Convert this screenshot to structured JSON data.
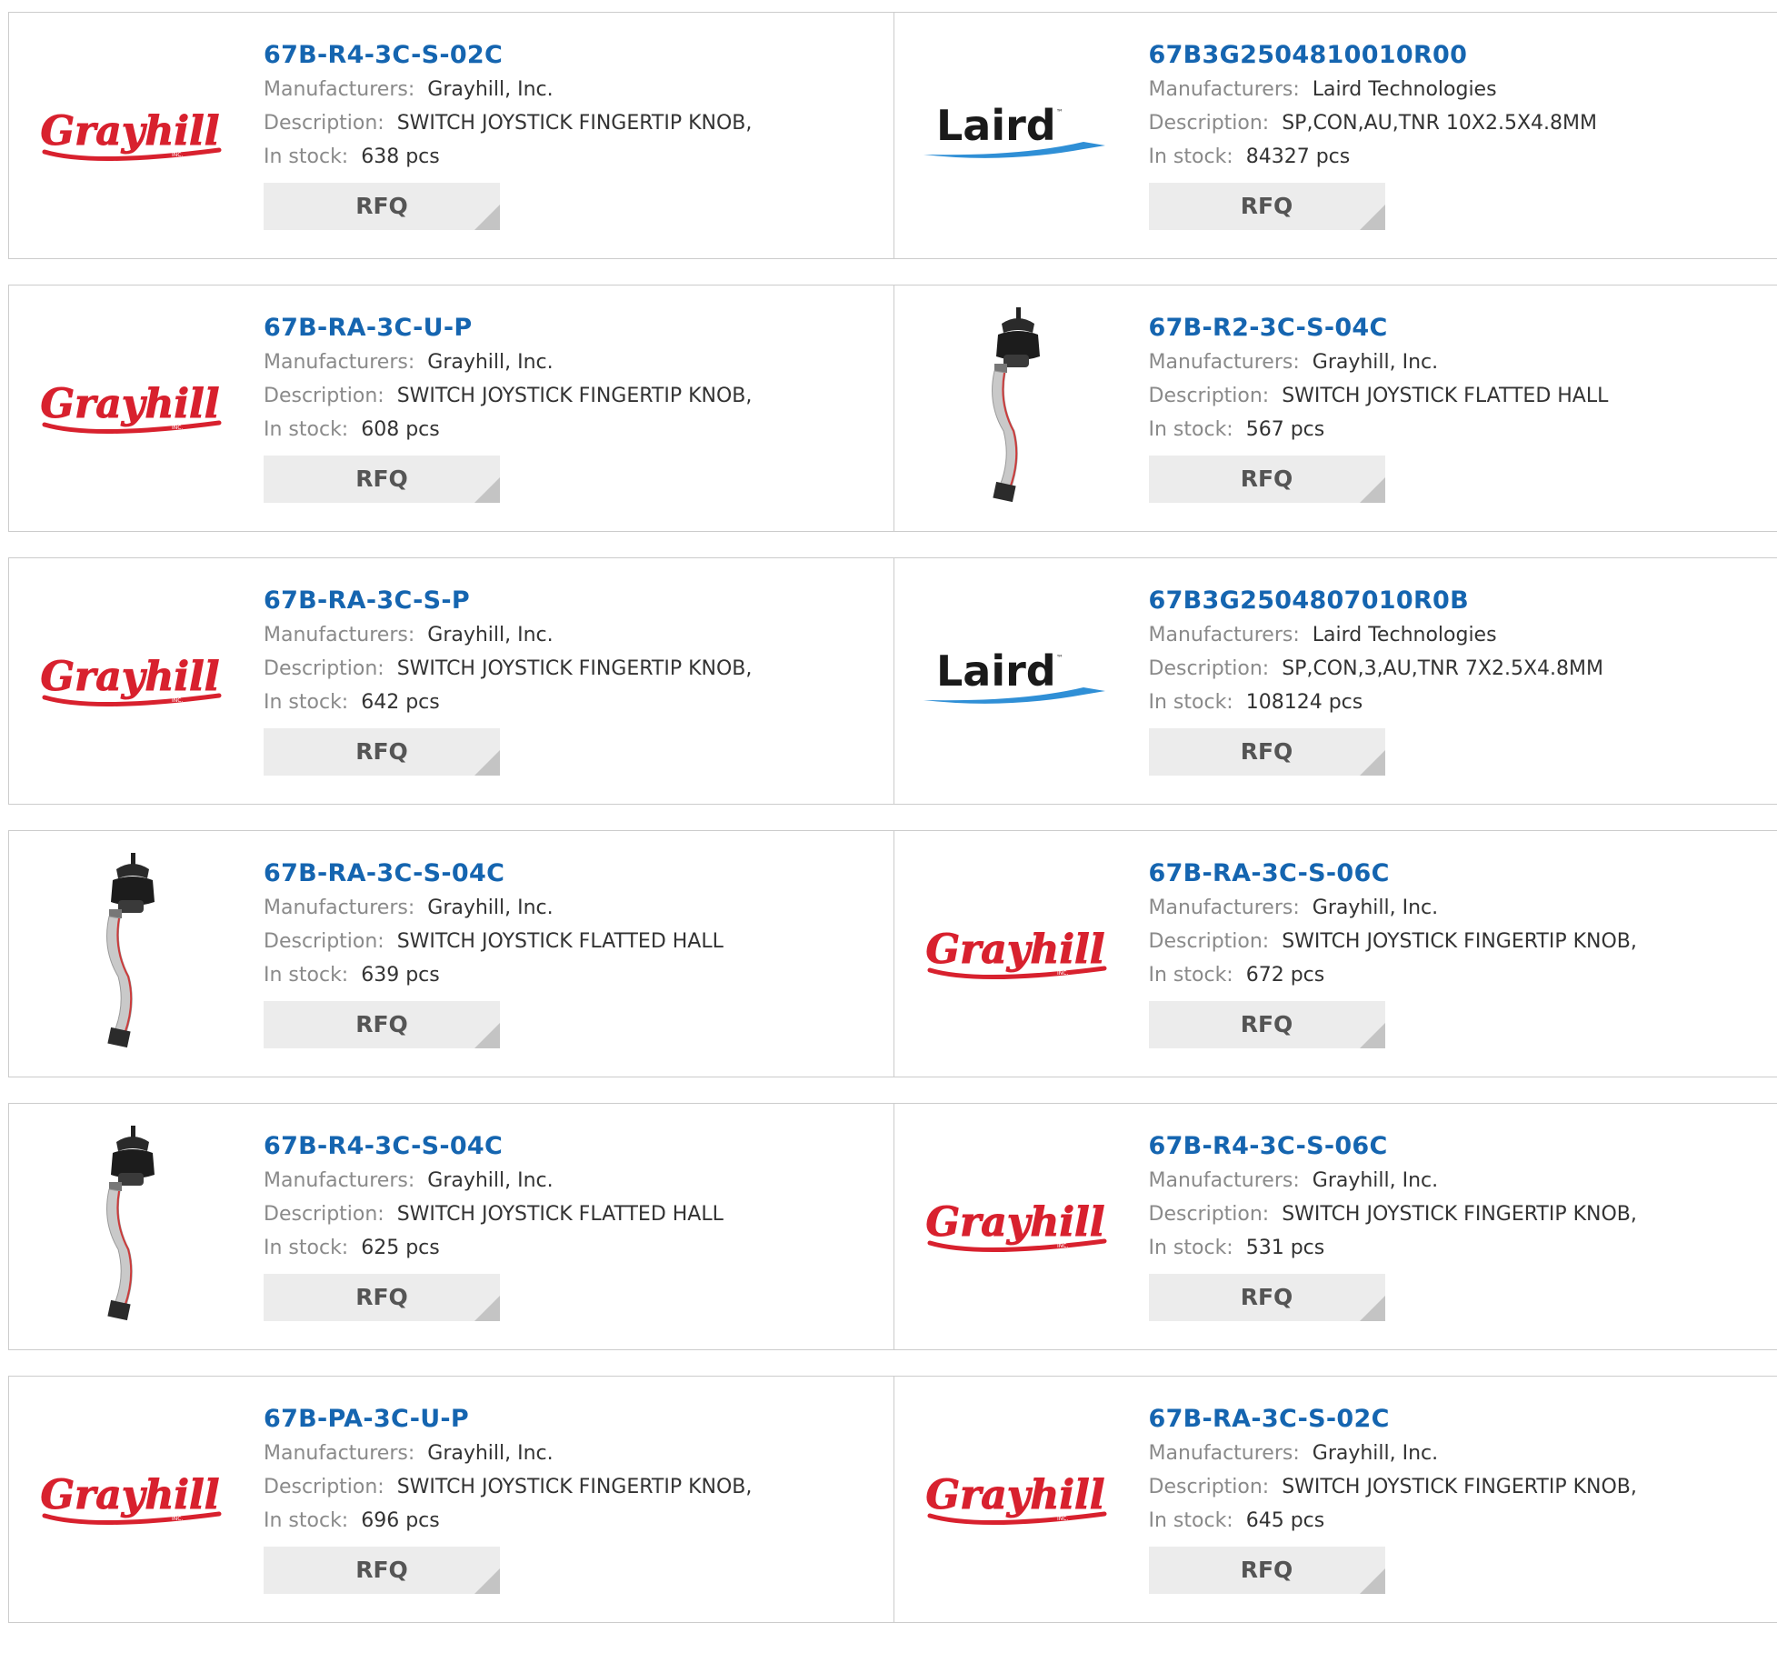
{
  "labels": {
    "manufacturer": "Manufacturers:",
    "description": "Description:",
    "stock": "In stock:",
    "rfq": "RFQ"
  },
  "colors": {
    "part_link": "#1565b0",
    "grayhill_red": "#d8212e",
    "laird_blue": "#2f8fd6",
    "label_gray": "#8a8a8a",
    "button_bg": "#ececec"
  },
  "logos": {
    "grayhill": "Grayhill",
    "grayhill_sub": "INC.",
    "laird": "Laird",
    "laird_tm": "™"
  },
  "products": [
    {
      "part": "67B-R4-3C-S-02C",
      "manufacturer": "Grayhill, Inc.",
      "description": "SWITCH JOYSTICK FINGERTIP KNOB,",
      "stock": "638 pcs",
      "image": "grayhill-logo"
    },
    {
      "part": "67B3G2504810010R00",
      "manufacturer": "Laird Technologies",
      "description": "SP,CON,AU,TNR 10X2.5X4.8MM",
      "stock": "84327 pcs",
      "image": "laird-logo"
    },
    {
      "part": "67B-RA-3C-U-P",
      "manufacturer": "Grayhill, Inc.",
      "description": "SWITCH JOYSTICK FINGERTIP KNOB,",
      "stock": "608 pcs",
      "image": "grayhill-logo"
    },
    {
      "part": "67B-R2-3C-S-04C",
      "manufacturer": "Grayhill, Inc.",
      "description": "SWITCH JOYSTICK FLATTED HALL",
      "stock": "567 pcs",
      "image": "joystick-photo"
    },
    {
      "part": "67B-RA-3C-S-P",
      "manufacturer": "Grayhill, Inc.",
      "description": "SWITCH JOYSTICK FINGERTIP KNOB,",
      "stock": "642 pcs",
      "image": "grayhill-logo"
    },
    {
      "part": "67B3G2504807010R0B",
      "manufacturer": "Laird Technologies",
      "description": "SP,CON,3,AU,TNR 7X2.5X4.8MM",
      "stock": "108124 pcs",
      "image": "laird-logo"
    },
    {
      "part": "67B-RA-3C-S-04C",
      "manufacturer": "Grayhill, Inc.",
      "description": "SWITCH JOYSTICK FLATTED HALL",
      "stock": "639 pcs",
      "image": "joystick-photo"
    },
    {
      "part": "67B-RA-3C-S-06C",
      "manufacturer": "Grayhill, Inc.",
      "description": "SWITCH JOYSTICK FINGERTIP KNOB,",
      "stock": "672 pcs",
      "image": "grayhill-logo"
    },
    {
      "part": "67B-R4-3C-S-04C",
      "manufacturer": "Grayhill, Inc.",
      "description": "SWITCH JOYSTICK FLATTED HALL",
      "stock": "625 pcs",
      "image": "joystick-photo"
    },
    {
      "part": "67B-R4-3C-S-06C",
      "manufacturer": "Grayhill, Inc.",
      "description": "SWITCH JOYSTICK FINGERTIP KNOB,",
      "stock": "531 pcs",
      "image": "grayhill-logo"
    },
    {
      "part": "67B-PA-3C-U-P",
      "manufacturer": "Grayhill, Inc.",
      "description": "SWITCH JOYSTICK FINGERTIP KNOB,",
      "stock": "696 pcs",
      "image": "grayhill-logo"
    },
    {
      "part": "67B-RA-3C-S-02C",
      "manufacturer": "Grayhill, Inc.",
      "description": "SWITCH JOYSTICK FINGERTIP KNOB,",
      "stock": "645 pcs",
      "image": "grayhill-logo"
    }
  ]
}
